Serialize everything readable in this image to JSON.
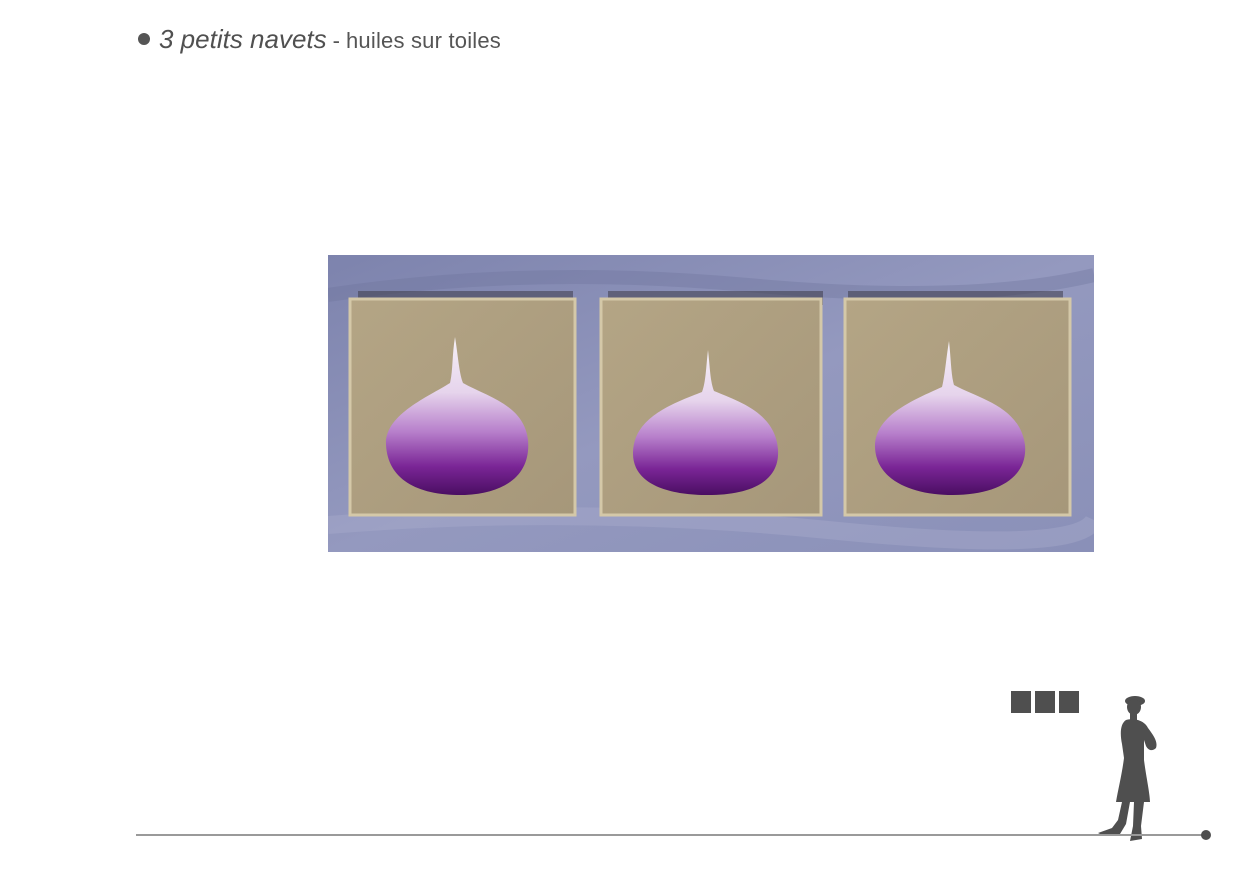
{
  "header": {
    "title_main": "3 petits navets",
    "separator": "-",
    "title_sub": "huiles sur toiles"
  },
  "artwork": {
    "canvases": 3
  },
  "scale": {
    "squares": 3
  },
  "colors": {
    "text": "#555555",
    "backdrop": "#8e93b8",
    "linen": "#b0a082",
    "turnip_top": "#f2eaf2",
    "turnip_bottom": "#6a1b8a",
    "silhouette": "#4f4f4f",
    "baseline": "#9a9a9a"
  }
}
